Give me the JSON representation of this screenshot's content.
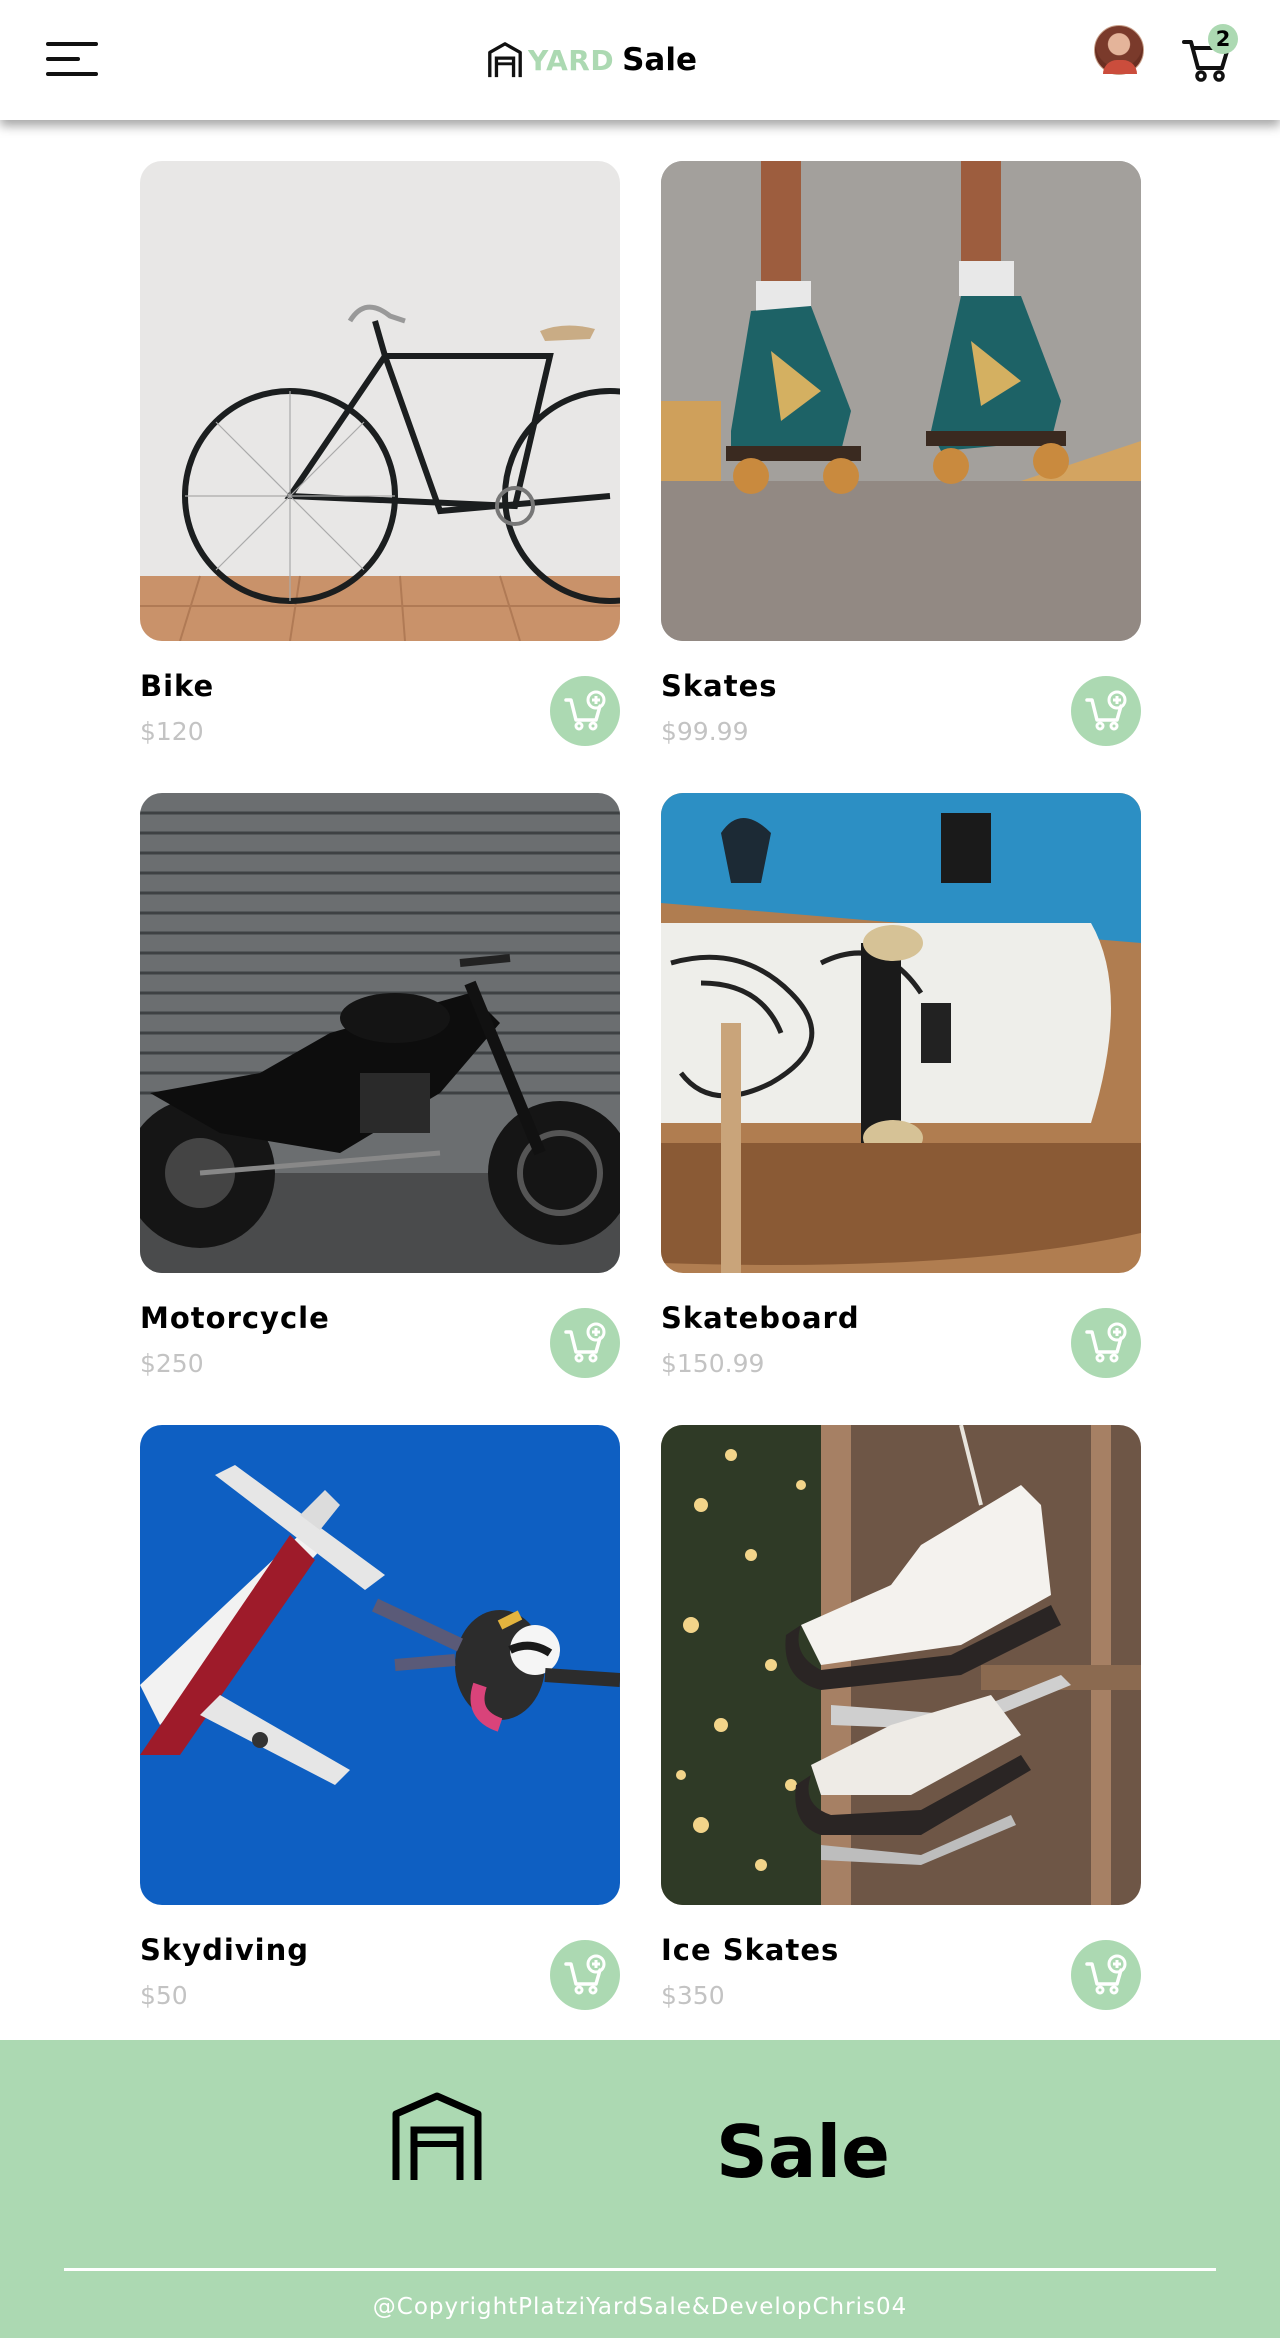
{
  "header": {
    "logo_yard": "YARD",
    "logo_sale": "Sale",
    "cart_count": "2"
  },
  "products": [
    {
      "name": "Bike",
      "price": "$120",
      "image": "bicycle-photo"
    },
    {
      "name": "Skates",
      "price": "$99.99",
      "image": "roller-skates-photo"
    },
    {
      "name": "Motorcycle",
      "price": "$250",
      "image": "motorcycle-photo"
    },
    {
      "name": "Skateboard",
      "price": "$150.99",
      "image": "skateboard-photo"
    },
    {
      "name": "Skydiving",
      "price": "$50",
      "image": "skydiving-photo"
    },
    {
      "name": "Ice Skates",
      "price": "$350",
      "image": "ice-skates-photo"
    }
  ],
  "footer": {
    "sale": "Sale",
    "copyright": "@CopyrightPlatziYardSale&DevelopChris04"
  },
  "colors": {
    "accent": "#acd9b2",
    "price": "#c3c3c3",
    "text": "#000000"
  },
  "icons": [
    "menu-icon",
    "garage-logo-icon",
    "avatar",
    "cart-icon",
    "add-to-cart-icon"
  ]
}
